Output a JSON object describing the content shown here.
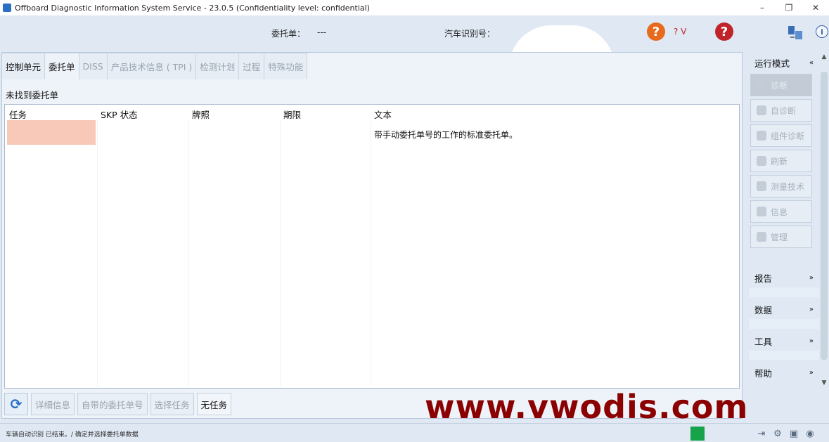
{
  "window": {
    "title": "Offboard Diagnostic Information System Service - 23.0.5 (Confidentiality level: confidential)",
    "controls": {
      "minimize": "–",
      "restore": "❐",
      "close": "✕"
    }
  },
  "header": {
    "order_label": "委托单：",
    "order_value": "---",
    "vin_label": "汽车识别号：",
    "help_text": "? V",
    "help_glyph": "?",
    "info_glyph": "i"
  },
  "tabs": [
    {
      "label": "控制单元",
      "state": "enabled"
    },
    {
      "label": "委托单",
      "state": "active"
    },
    {
      "label": "DISS",
      "state": "disabled"
    },
    {
      "label": "产品技术信息 ( TPI )",
      "state": "disabled"
    },
    {
      "label": "检测计划",
      "state": "disabled"
    },
    {
      "label": "过程",
      "state": "disabled"
    },
    {
      "label": "特殊功能",
      "state": "disabled"
    }
  ],
  "main": {
    "subheading": "未找到委托单",
    "columns": [
      "任务",
      "SKP 状态",
      "牌照",
      "期限",
      "文本"
    ],
    "rows": [
      {
        "task": "",
        "skp": "",
        "plate": "",
        "deadline": "",
        "text": "带手动委托单号的工作的标准委托单。"
      }
    ],
    "buttons": [
      {
        "label": "详细信息",
        "enabled": false
      },
      {
        "label": "自带的委托单号",
        "enabled": false
      },
      {
        "label": "选择任务",
        "enabled": false
      },
      {
        "label": "无任务",
        "enabled": true
      }
    ],
    "refresh_glyph": "⟳"
  },
  "sidebar": {
    "mode_header": "运行模式",
    "collapse_glyph": "«",
    "expand_glyph": "»",
    "modes": [
      {
        "label": "诊断",
        "active": true
      },
      {
        "label": "自诊断",
        "active": false
      },
      {
        "label": "组件诊断",
        "active": false
      },
      {
        "label": "刷新",
        "active": false
      },
      {
        "label": "测量技术",
        "active": false
      },
      {
        "label": "信息",
        "active": false
      },
      {
        "label": "管理",
        "active": false
      }
    ],
    "sections": [
      "报告",
      "数据",
      "工具",
      "帮助"
    ]
  },
  "watermark": "www.vwodis.com",
  "status": {
    "text": "车辆自动识别 已结束。/ 确定并选择委托单数据",
    "indicator_color": "#17a34a"
  }
}
